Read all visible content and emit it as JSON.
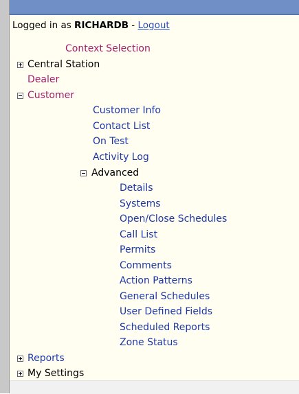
{
  "header": {
    "logged_in_prefix": "Logged in as ",
    "username": "RICHARDB",
    "separator": " - ",
    "logout_label": "Logout"
  },
  "nav": {
    "context_selection": "Context Selection",
    "central_station": "Central Station",
    "dealer": "Dealer",
    "customer": "Customer",
    "customer_children": {
      "customer_info": "Customer Info",
      "contact_list": "Contact List",
      "on_test": "On Test",
      "activity_log": "Activity Log"
    },
    "advanced": "Advanced",
    "advanced_children": {
      "details": "Details",
      "systems": "Systems",
      "open_close_schedules": "Open/Close Schedules",
      "call_list": "Call List",
      "permits": "Permits",
      "comments": "Comments",
      "action_patterns": "Action Patterns",
      "general_schedules": "General Schedules",
      "user_defined_fields": "User Defined Fields",
      "scheduled_reports": "Scheduled Reports",
      "zone_status": "Zone Status"
    },
    "reports": "Reports",
    "my_settings": "My Settings"
  },
  "icons": {
    "expand": "plus-box-icon",
    "collapse": "minus-box-icon"
  },
  "colors": {
    "header_bar": "#6f8fc6",
    "panel_bg": "#fffef0",
    "link_purple": "#a31c6c",
    "link_blue": "#1d38a8",
    "logout_link": "#2b4dbb"
  }
}
